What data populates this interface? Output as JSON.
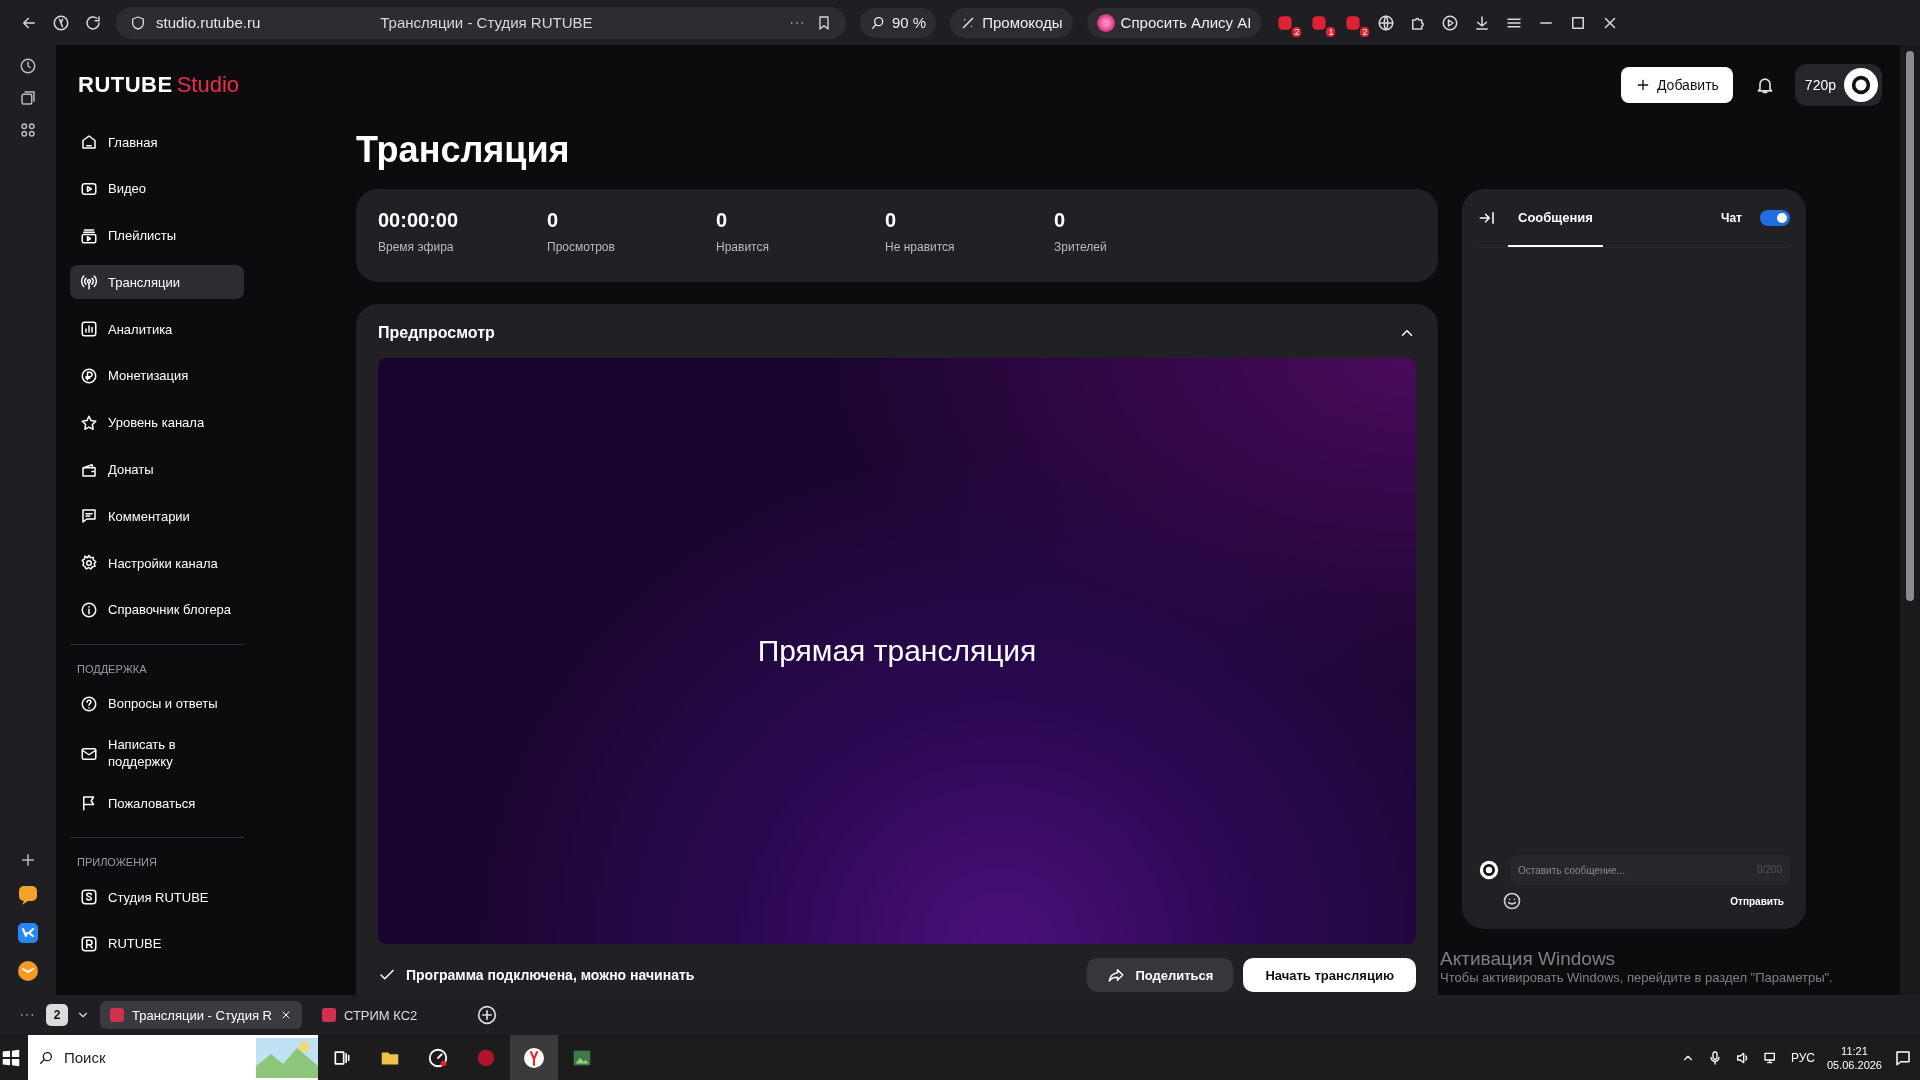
{
  "browser": {
    "url": "studio.rutube.ru",
    "page_title": "Трансляции - Студия RUTUBE",
    "zoom": "90 %",
    "promo": "Промокоды",
    "alice": "Спросить Алису AI",
    "badges": [
      "2",
      "1",
      "2"
    ]
  },
  "app_header": {
    "brand": "RUTUBE",
    "product": "Studio",
    "add_button": "Добавить",
    "quality": "720p"
  },
  "sidebar": {
    "items": [
      {
        "label": "Главная",
        "selected": false
      },
      {
        "label": "Видео",
        "selected": false
      },
      {
        "label": "Плейлисты",
        "selected": false
      },
      {
        "label": "Трансляции",
        "selected": true
      },
      {
        "label": "Аналитика",
        "selected": false
      },
      {
        "label": "Монетизация",
        "selected": false
      },
      {
        "label": "Уровень канала",
        "selected": false
      },
      {
        "label": "Донаты",
        "selected": false
      },
      {
        "label": "Комментарии",
        "selected": false
      },
      {
        "label": "Настройки канала",
        "selected": false
      },
      {
        "label": "Справочник блогера",
        "selected": false
      }
    ],
    "sections": [
      {
        "title": "ПОДДЕРЖКА",
        "items": [
          {
            "label": "Вопросы и ответы",
            "selected": false
          },
          {
            "label": "Написать в поддержку",
            "selected": false
          },
          {
            "label": "Пожаловаться",
            "selected": false
          }
        ]
      },
      {
        "title": "ПРИЛОЖЕНИЯ",
        "items": [
          {
            "label": "Студия RUTUBE",
            "selected": false
          },
          {
            "label": "RUTUBE",
            "selected": false
          }
        ]
      }
    ]
  },
  "page_title": "Трансляция",
  "stats": [
    {
      "value": "00:00:00",
      "label": "Время эфира"
    },
    {
      "value": "0",
      "label": "Просмотров"
    },
    {
      "value": "0",
      "label": "Нравится"
    },
    {
      "value": "0",
      "label": "Не нравится"
    },
    {
      "value": "0",
      "label": "Зрителей"
    }
  ],
  "preview": {
    "title": "Предпросмотр",
    "expanded": true,
    "overlay_text": "Прямая трансляция",
    "status": "Программа подключена, можно начинать",
    "share_button": "Поделиться",
    "start_button": "Начать трансляцию"
  },
  "chat": {
    "tab": {
      "label": "Сообщения",
      "selected": true
    },
    "toggle_label": "Чат",
    "chat_on": true,
    "placeholder": "Оставить сообщение...",
    "counter": "0/200",
    "send_button": "Отправить"
  },
  "browser_tabs": {
    "count": "2",
    "tabs": [
      {
        "title": "Трансляции - Студия R",
        "selected": true
      },
      {
        "title": "СТРИМ КС2",
        "selected": false
      }
    ]
  },
  "windows_activation": {
    "title": "Активация Windows",
    "text": "Чтобы активировать Windows, перейдите в раздел \"Параметры\"."
  },
  "taskbar": {
    "search_placeholder": "Поиск",
    "language": "РУС",
    "time": "11:21",
    "date": "05.06.2026"
  }
}
